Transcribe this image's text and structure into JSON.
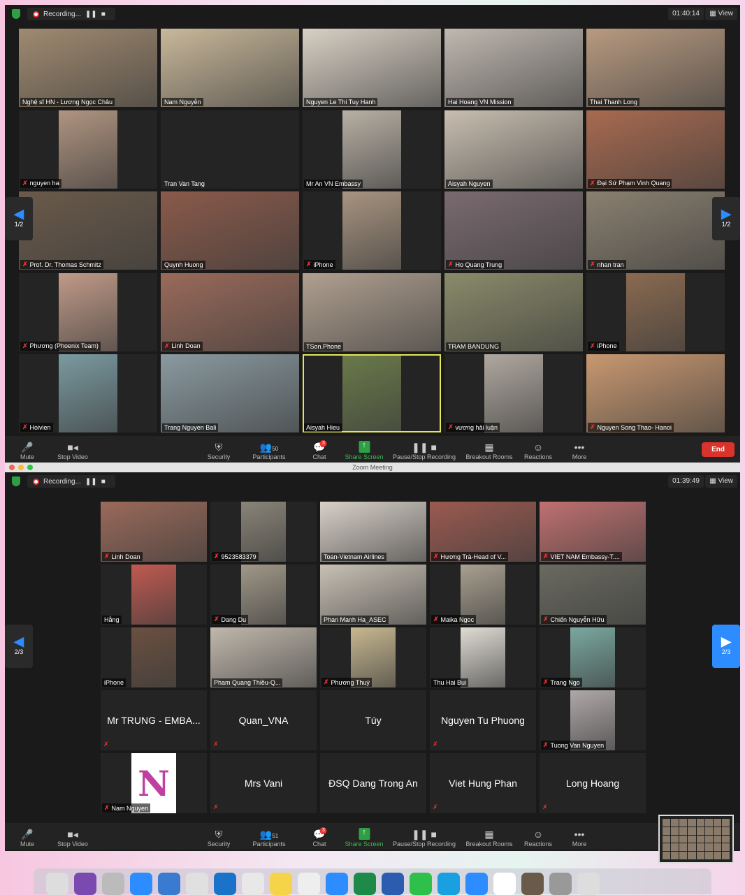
{
  "colors": {
    "accent": "#2d8cff",
    "recording": "#e33333",
    "active_speaker": "#e5e55a",
    "end": "#d9342b",
    "share": "#2ea043"
  },
  "window_title": "Zoom Meeting",
  "meeting1": {
    "recording_label": "Recording...",
    "timer": "01:40:14",
    "view_label": "View",
    "page": "1/2",
    "participants_count": "50",
    "chat_badge": "3",
    "tiles": [
      {
        "name": "Nghệ sĩ HN - Lương Ngọc Châu",
        "muted": false,
        "video": "#a08a70"
      },
      {
        "name": "Nam Nguyễn",
        "muted": false,
        "video": "#c9b89a"
      },
      {
        "name": "Nguyen Le Thi Tuy Hanh",
        "muted": false,
        "video": "#d8d0c4"
      },
      {
        "name": "Hai Hoang VN Mission",
        "muted": false,
        "video": "#c0b8b0"
      },
      {
        "name": "Thai Thanh Long",
        "muted": false,
        "video": "#b89a80"
      },
      {
        "name": "nguyen ha",
        "muted": true,
        "video": "#b09480",
        "portrait": true
      },
      {
        "name": "Tran Van Tang",
        "muted": false,
        "video": null
      },
      {
        "name": "Mr An VN Embassy",
        "muted": false,
        "video": "#b8b0a4",
        "portrait": true
      },
      {
        "name": "Aisyah Nguyen",
        "muted": false,
        "video": "#c8beb0"
      },
      {
        "name": "Đại Sứ Phạm Vinh Quang",
        "muted": true,
        "video": "#a86a50"
      },
      {
        "name": "Prof. Dr. Thomas Schmitz",
        "muted": true,
        "video": "#6a5a4a"
      },
      {
        "name": "Quynh Huong",
        "muted": false,
        "video": "#8a5a4a"
      },
      {
        "name": "iPhone",
        "muted": true,
        "video": "#a89480",
        "portrait": true
      },
      {
        "name": "Ho Quang Trung",
        "muted": true,
        "video": "#7a6a70"
      },
      {
        "name": "nhan tran",
        "muted": true,
        "video": "#8a8070"
      },
      {
        "name": "Phương (Phoenix Team)",
        "muted": true,
        "video": "#c09a88",
        "portrait": true
      },
      {
        "name": "Linh Doan",
        "muted": true,
        "video": "#9a6a5a"
      },
      {
        "name": "TSon.Phone",
        "muted": false,
        "video": "#b0a090"
      },
      {
        "name": "TRAM BANDUNG",
        "muted": false,
        "video": "#8a8a6a"
      },
      {
        "name": "iPhone",
        "muted": true,
        "video": "#8a6a50",
        "portrait": true
      },
      {
        "name": "Hoivien",
        "muted": true,
        "video": "#7a9aa0",
        "portrait": true
      },
      {
        "name": "Trang Nguyen Bali",
        "muted": false,
        "video": "#8a9aa0"
      },
      {
        "name": "Aisyah Hieu",
        "muted": false,
        "video": "#6a7a4a",
        "portrait": true,
        "active": true
      },
      {
        "name": "vương hải luận",
        "muted": true,
        "video": "#b0a8a0",
        "portrait": true
      },
      {
        "name": "Nguyen Song Thao- Hanoi",
        "muted": true,
        "video": "#c89870"
      }
    ]
  },
  "meeting2": {
    "recording_label": "Recording...",
    "timer": "01:39:49",
    "view_label": "View",
    "page": "2/3",
    "participants_count": "51",
    "chat_badge": "3",
    "tiles": [
      {
        "name": "Linh Doan",
        "muted": true,
        "video": "#9a6a5a"
      },
      {
        "name": "9523583379",
        "muted": true,
        "video": "#8a8478",
        "portrait": true
      },
      {
        "name": "Toan-Vietnam Airlines",
        "muted": false,
        "video": "#d8d0c8"
      },
      {
        "name": "Hương Trà-Head of V...",
        "muted": true,
        "video": "#9a5a50"
      },
      {
        "name": "VIET NAM Embassy-T....",
        "muted": true,
        "video": "#c07070"
      },
      {
        "name": "Hằng",
        "muted": false,
        "video": "#c05a50",
        "portrait": true
      },
      {
        "name": "Dang Du",
        "muted": true,
        "video": "#a09888",
        "portrait": true
      },
      {
        "name": "Phan Manh Ha_ASEC",
        "muted": false,
        "video": "#c8c0b4"
      },
      {
        "name": "Maika Ngoc",
        "muted": true,
        "video": "#a8a090",
        "portrait": true
      },
      {
        "name": "Chiến Nguyễn Hữu",
        "muted": true,
        "video": "#6a6a60"
      },
      {
        "name": "iPhone",
        "muted": false,
        "video": "#6a5040",
        "portrait": true
      },
      {
        "name": "Pham Quang Thiều-Q...",
        "muted": false,
        "video": "#c0b8ac"
      },
      {
        "name": "Phương Thuý",
        "muted": true,
        "video": "#c8b890",
        "portrait": true
      },
      {
        "name": "Thu Hai Bui",
        "muted": false,
        "video": "#e0dcd4",
        "portrait": true
      },
      {
        "name": "Trang Ngo",
        "muted": true,
        "video": "#7aa8a0",
        "portrait": true
      },
      {
        "name": "Mr TRUNG - EMBA...",
        "muted": true,
        "video": null
      },
      {
        "name": "Quan_VNA",
        "muted": true,
        "video": null
      },
      {
        "name": "Túy",
        "muted": false,
        "video": null
      },
      {
        "name": "Nguyen Tu Phuong",
        "muted": true,
        "video": null
      },
      {
        "name": "Tuong Van Nguyen",
        "muted": true,
        "video": "#b0a8a8",
        "portrait": true
      },
      {
        "name": "Nam Nguyen",
        "muted": true,
        "video": "#c040a0",
        "portrait": true,
        "logo": "N"
      },
      {
        "name": "Mrs Vani",
        "muted": true,
        "video": null
      },
      {
        "name": "ĐSQ Dang Trong An",
        "muted": false,
        "video": null
      },
      {
        "name": "Viet Hung Phan",
        "muted": true,
        "video": null
      },
      {
        "name": "Long Hoang",
        "muted": true,
        "video": null
      }
    ]
  },
  "toolbar": {
    "mute": "Mute",
    "stop_video": "Stop Video",
    "security": "Security",
    "participants": "Participants",
    "chat": "Chat",
    "share_screen": "Share Screen",
    "recording": "Pause/Stop Recording",
    "breakout": "Breakout Rooms",
    "reactions": "Reactions",
    "more": "More",
    "end": "End"
  }
}
